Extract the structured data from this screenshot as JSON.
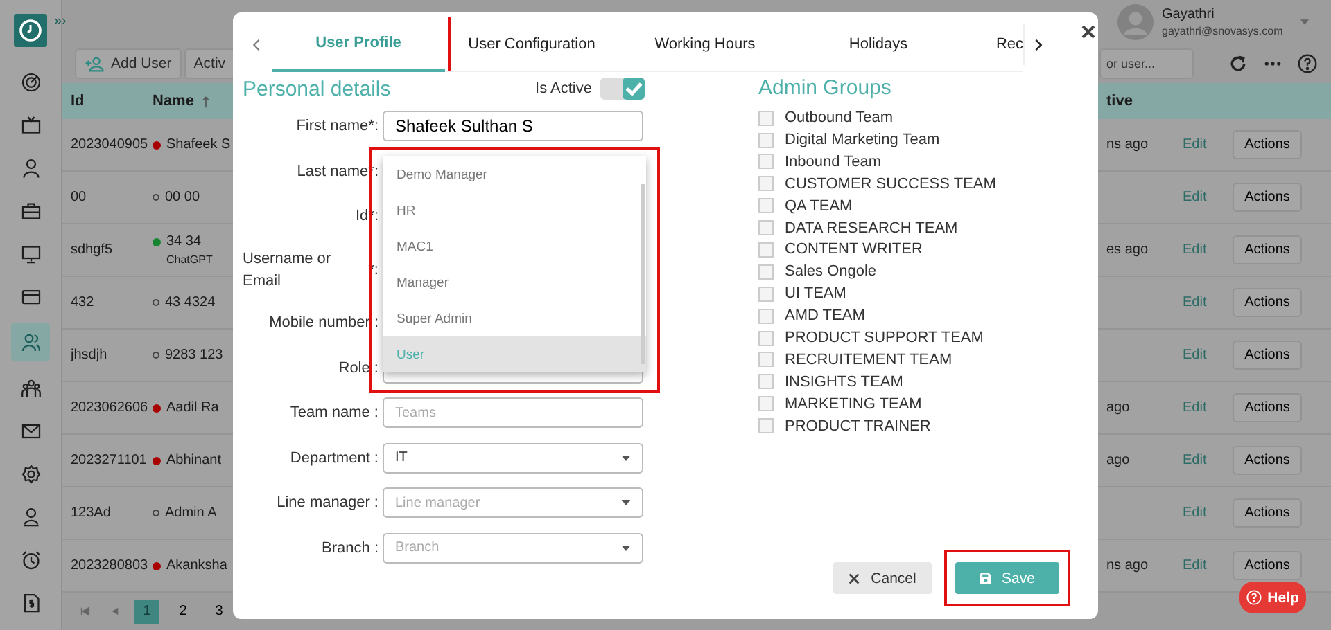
{
  "sidebar": {
    "items": [
      {
        "kind": "target",
        "selected": false
      },
      {
        "kind": "tv",
        "selected": false
      },
      {
        "kind": "user",
        "selected": false
      },
      {
        "kind": "briefcase",
        "selected": false
      },
      {
        "kind": "monitor",
        "selected": false
      },
      {
        "kind": "card",
        "selected": false
      },
      {
        "kind": "users",
        "selected": true
      },
      {
        "kind": "group",
        "selected": false
      },
      {
        "kind": "mail",
        "selected": false
      },
      {
        "kind": "gear",
        "selected": false
      },
      {
        "kind": "badge",
        "selected": false
      },
      {
        "kind": "alarm",
        "selected": false
      },
      {
        "kind": "invoice",
        "selected": false
      }
    ]
  },
  "topbar": {
    "toggle": "»›",
    "user": {
      "name": "Gayathri",
      "email": "gayathri@snovasys.com"
    }
  },
  "toolbar": {
    "buttons": [
      {
        "label": "Add User",
        "kind": "add"
      },
      {
        "label": "Activ",
        "kind": "plain"
      }
    ],
    "search": {
      "placeholder": "or user..."
    }
  },
  "table": {
    "columns": [
      {
        "label": "Id",
        "sorted": false
      },
      {
        "label": "Name",
        "sorted": true
      },
      {
        "label": "tive",
        "sorted": false
      }
    ],
    "rows": [
      {
        "id": "2023040905",
        "color": "#a80000",
        "name": "Shafeek S",
        "last_active": "ns ago",
        "edit": "Edit",
        "action": "Actions"
      },
      {
        "id": "00",
        "name": "00 00",
        "edit": "Edit",
        "action": "Actions"
      },
      {
        "id": "sdhgf5",
        "color": "#17852f",
        "name": "34 34",
        "sub": "ChatGPT",
        "last_active": "es ago",
        "edit": "Edit",
        "action": "Actions"
      },
      {
        "id": "432",
        "name": "43 4324",
        "edit": "Edit",
        "action": "Actions"
      },
      {
        "id": "jhsdjh",
        "name": "9283 123",
        "edit": "Edit",
        "action": "Actions"
      },
      {
        "id": "2023062606",
        "color": "#a80000",
        "name": "Aadil Ra",
        "last_active": "ago",
        "edit": "Edit",
        "action": "Actions"
      },
      {
        "id": "2023271101",
        "color": "#a80000",
        "name": "Abhinant",
        "last_active": "ago",
        "edit": "Edit",
        "action": "Actions"
      },
      {
        "id": "123Ad",
        "name": "Admin A",
        "edit": "Edit",
        "action": "Actions"
      },
      {
        "id": "2023280803",
        "color": "#a80000",
        "name": "Akanksha",
        "last_active": "ns ago",
        "edit": "Edit",
        "action": "Actions"
      }
    ]
  },
  "pagination": {
    "pages": [
      {
        "label": "1",
        "selected": true
      },
      {
        "label": "2",
        "selected": false
      },
      {
        "label": "3",
        "selected": false
      }
    ]
  },
  "modal": {
    "tabs": [
      {
        "label": "User Profile",
        "selected": true,
        "highlighted": true
      },
      {
        "label": "User Configuration",
        "selected": false,
        "highlighted": false
      },
      {
        "label": "Working Hours",
        "selected": false,
        "highlighted": false
      },
      {
        "label": "Holidays",
        "selected": false,
        "highlighted": false
      },
      {
        "label": "Rec",
        "selected": false,
        "highlighted": false
      }
    ],
    "personal": {
      "title": "Personal details",
      "active": {
        "label": "Is Active",
        "on": true
      },
      "fields": [
        {
          "label": "First name*:",
          "kind": "text",
          "value": "Shafeek Sulthan S"
        },
        {
          "label": "Last name*:",
          "kind": "covered"
        },
        {
          "label": "Id*:",
          "kind": "covered"
        },
        {
          "label": "Username or Email",
          "marker": "*:",
          "kind": "covered"
        },
        {
          "label": "Mobile number :",
          "kind": "covered"
        },
        {
          "label": "Role :",
          "kind": "select"
        },
        {
          "label": "Team name :",
          "kind": "text",
          "placeholder": "Teams"
        },
        {
          "label": "Department :",
          "kind": "select",
          "value": "IT"
        },
        {
          "label": "Line manager :",
          "kind": "select",
          "placeholder": "Line manager"
        },
        {
          "label": "Branch :",
          "kind": "select",
          "placeholder": "Branch"
        }
      ],
      "role_menu": {
        "highlighted": true,
        "options": [
          {
            "label": "Demo Manager",
            "selected": false
          },
          {
            "label": "HR",
            "selected": false
          },
          {
            "label": "MAC1",
            "selected": false
          },
          {
            "label": "Manager",
            "selected": false
          },
          {
            "label": "Super Admin",
            "selected": false
          },
          {
            "label": "User",
            "selected": true
          }
        ]
      }
    },
    "admin_groups": {
      "title": "Admin Groups",
      "items": [
        {
          "label": "Outbound Team",
          "checked": false
        },
        {
          "label": "Digital Marketing Team",
          "checked": false
        },
        {
          "label": "Inbound Team",
          "checked": false
        },
        {
          "label": "CUSTOMER SUCCESS TEAM",
          "checked": false
        },
        {
          "label": "QA TEAM",
          "checked": false
        },
        {
          "label": "DATA RESEARCH TEAM",
          "checked": false
        },
        {
          "label": "CONTENT WRITER",
          "checked": false
        },
        {
          "label": "Sales Ongole",
          "checked": false
        },
        {
          "label": "UI TEAM",
          "checked": false
        },
        {
          "label": "AMD TEAM",
          "checked": false
        },
        {
          "label": "PRODUCT SUPPORT TEAM",
          "checked": false
        },
        {
          "label": "RECRUITEMENT TEAM",
          "checked": false
        },
        {
          "label": "INSIGHTS TEAM",
          "checked": false
        },
        {
          "label": "MARKETING TEAM",
          "checked": false
        },
        {
          "label": "PRODUCT TRAINER",
          "checked": false
        }
      ]
    },
    "footer": {
      "buttons": [
        {
          "label": "Cancel",
          "kind": "cancel",
          "highlighted": false
        },
        {
          "label": "Save",
          "kind": "save",
          "highlighted": true
        }
      ]
    }
  },
  "help": {
    "label": "Help"
  }
}
